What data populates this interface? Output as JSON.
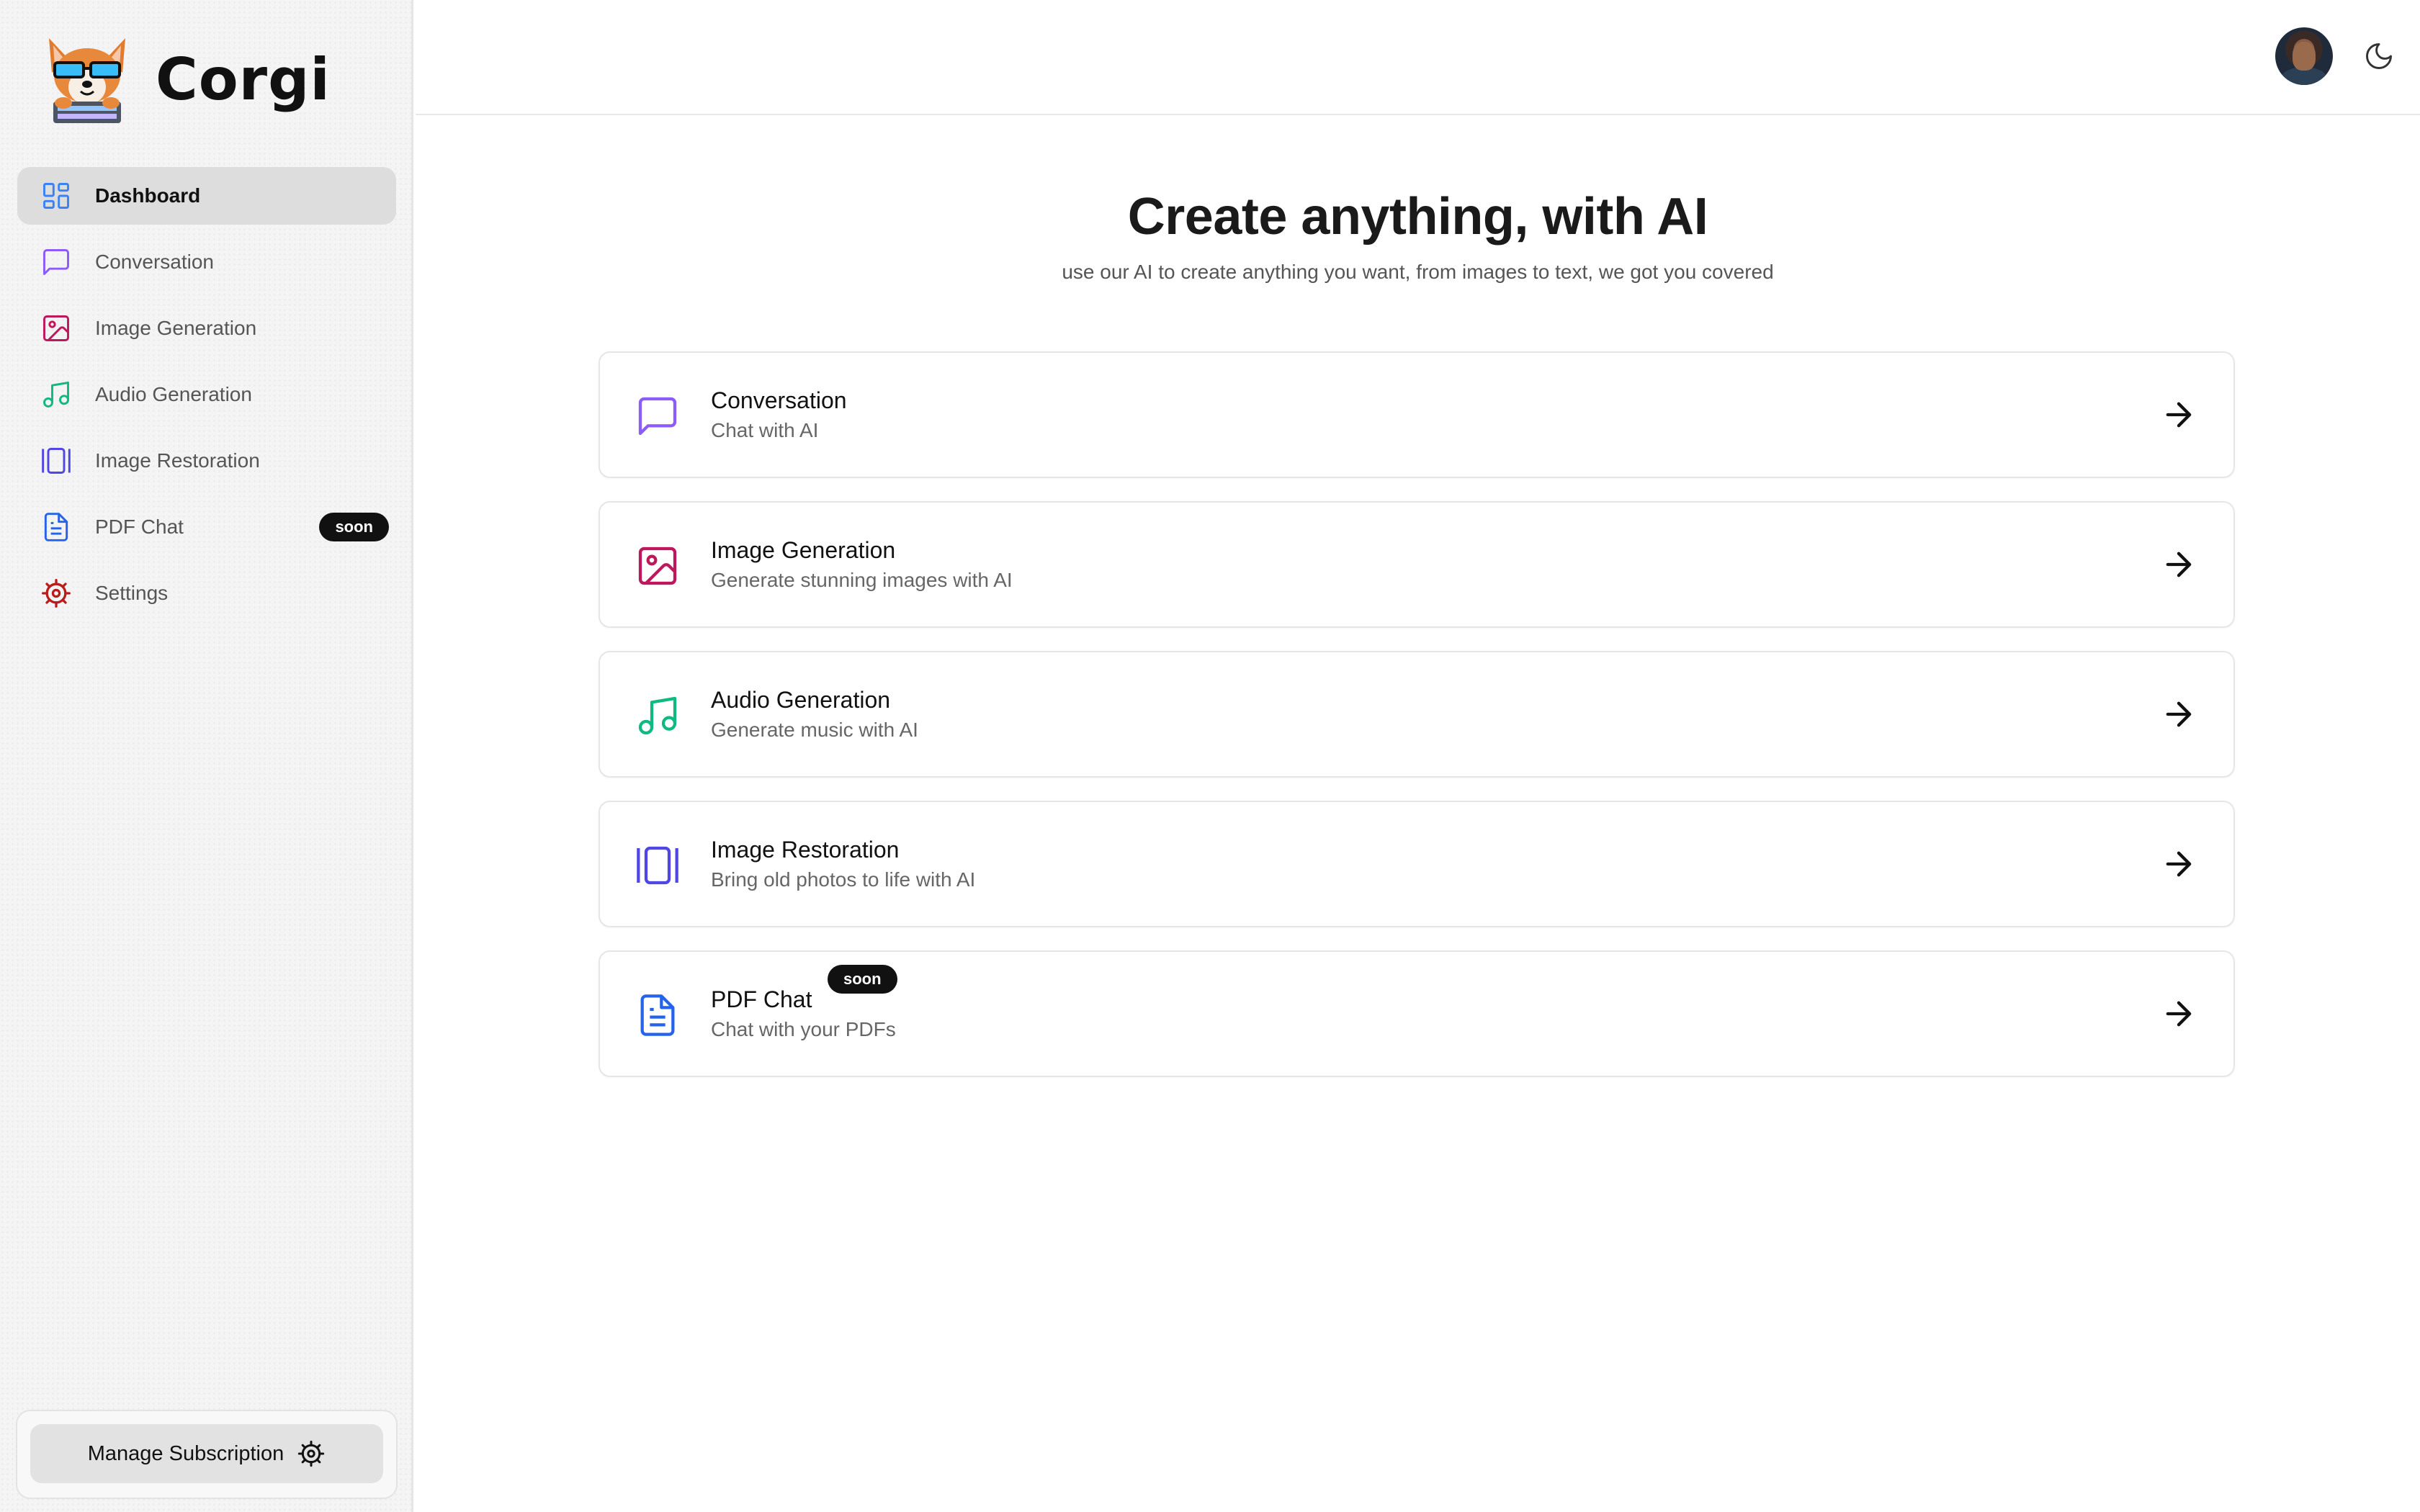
{
  "brand": {
    "name": "Corgi"
  },
  "sidebar": {
    "items": [
      {
        "label": "Dashboard",
        "icon": "dashboard-icon",
        "color": "#3b82f6",
        "active": true
      },
      {
        "label": "Conversation",
        "icon": "message-square-icon",
        "color": "#8b5cf6"
      },
      {
        "label": "Image Generation",
        "icon": "image-icon",
        "color": "#be185d"
      },
      {
        "label": "Audio Generation",
        "icon": "music-icon",
        "color": "#10b981"
      },
      {
        "label": "Image Restoration",
        "icon": "gallery-vertical-icon",
        "color": "#4f46e5"
      },
      {
        "label": "PDF Chat",
        "icon": "file-text-icon",
        "color": "#2563eb",
        "badge": "soon"
      },
      {
        "label": "Settings",
        "icon": "settings-icon",
        "color": "#b91c1c"
      }
    ],
    "manage_subscription_label": "Manage Subscription"
  },
  "header": {
    "avatar_icon": "user-avatar",
    "theme_icon": "moon-icon"
  },
  "main": {
    "title": "Create anything, with AI",
    "subtitle": "use our AI to create anything you want, from images to text, we got you covered",
    "cards": [
      {
        "title": "Conversation",
        "description": "Chat with AI",
        "icon": "message-square-icon",
        "color": "#8b5cf6"
      },
      {
        "title": "Image Generation",
        "description": "Generate stunning images with AI",
        "icon": "image-icon",
        "color": "#be185d"
      },
      {
        "title": "Audio Generation",
        "description": "Generate music with AI",
        "icon": "music-icon",
        "color": "#10b981"
      },
      {
        "title": "Image Restoration",
        "description": "Bring old photos to life with AI",
        "icon": "gallery-vertical-icon",
        "color": "#4f46e5"
      },
      {
        "title": "PDF Chat",
        "description": "Chat with your PDFs",
        "icon": "file-text-icon",
        "color": "#2563eb",
        "badge": "soon"
      }
    ],
    "arrow_icon": "arrow-right-icon"
  }
}
